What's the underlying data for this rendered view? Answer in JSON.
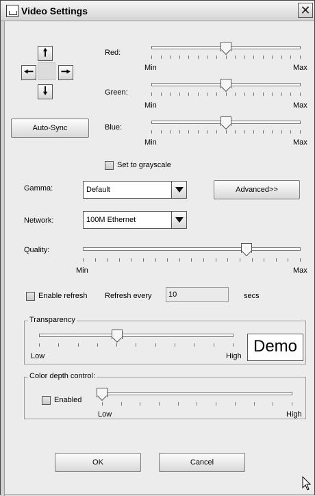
{
  "window": {
    "title": "Video Settings",
    "icon": "window-app-icon",
    "close_glyph": "✕"
  },
  "navigation": {
    "up_glyph": "🠕",
    "down_glyph": "🠗",
    "left_glyph": "🠔",
    "right_glyph": "🠖",
    "auto_sync_label": "Auto-Sync"
  },
  "color_sliders": [
    {
      "label": "Red:",
      "min_label": "Min",
      "max_label": "Max",
      "value": 0.5
    },
    {
      "label": "Green:",
      "min_label": "Min",
      "max_label": "Max",
      "value": 0.5
    },
    {
      "label": "Blue:",
      "min_label": "Min",
      "max_label": "Max",
      "value": 0.5
    }
  ],
  "grayscale": {
    "label": "Set to grayscale",
    "checked": false
  },
  "gamma": {
    "label": "Gamma:",
    "value": "Default",
    "advanced_label": "Advanced>>"
  },
  "network": {
    "label": "Network:",
    "value": "100M Ethernet"
  },
  "quality": {
    "label": "Quality:",
    "min_label": "Min",
    "max_label": "Max",
    "value": 0.75
  },
  "refresh": {
    "enable_label": "Enable refresh",
    "enabled": false,
    "every_label": "Refresh every",
    "value": "10",
    "unit_label": "secs"
  },
  "transparency": {
    "title": "Transparency",
    "low_label": "Low",
    "high_label": "High",
    "value": 0.4,
    "demo_label": "Demo"
  },
  "color_depth": {
    "title": "Color depth control:",
    "enabled_label": "Enabled",
    "enabled": false,
    "low_label": "Low",
    "high_label": "High",
    "value": 0.0
  },
  "buttons": {
    "ok_label": "OK",
    "cancel_label": "Cancel"
  }
}
